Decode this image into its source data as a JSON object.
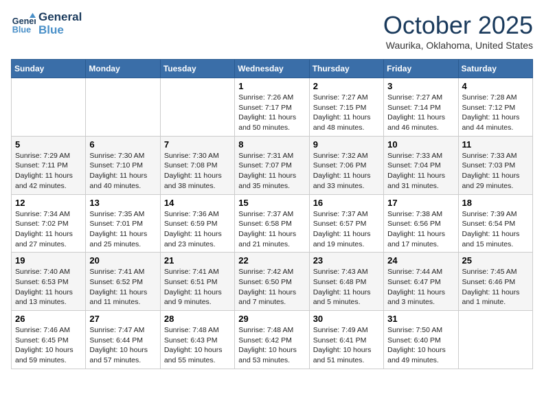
{
  "header": {
    "logo_line1": "General",
    "logo_line2": "Blue",
    "month": "October 2025",
    "location": "Waurika, Oklahoma, United States"
  },
  "weekdays": [
    "Sunday",
    "Monday",
    "Tuesday",
    "Wednesday",
    "Thursday",
    "Friday",
    "Saturday"
  ],
  "weeks": [
    [
      {
        "day": "",
        "info": ""
      },
      {
        "day": "",
        "info": ""
      },
      {
        "day": "",
        "info": ""
      },
      {
        "day": "1",
        "info": "Sunrise: 7:26 AM\nSunset: 7:17 PM\nDaylight: 11 hours\nand 50 minutes."
      },
      {
        "day": "2",
        "info": "Sunrise: 7:27 AM\nSunset: 7:15 PM\nDaylight: 11 hours\nand 48 minutes."
      },
      {
        "day": "3",
        "info": "Sunrise: 7:27 AM\nSunset: 7:14 PM\nDaylight: 11 hours\nand 46 minutes."
      },
      {
        "day": "4",
        "info": "Sunrise: 7:28 AM\nSunset: 7:12 PM\nDaylight: 11 hours\nand 44 minutes."
      }
    ],
    [
      {
        "day": "5",
        "info": "Sunrise: 7:29 AM\nSunset: 7:11 PM\nDaylight: 11 hours\nand 42 minutes."
      },
      {
        "day": "6",
        "info": "Sunrise: 7:30 AM\nSunset: 7:10 PM\nDaylight: 11 hours\nand 40 minutes."
      },
      {
        "day": "7",
        "info": "Sunrise: 7:30 AM\nSunset: 7:08 PM\nDaylight: 11 hours\nand 38 minutes."
      },
      {
        "day": "8",
        "info": "Sunrise: 7:31 AM\nSunset: 7:07 PM\nDaylight: 11 hours\nand 35 minutes."
      },
      {
        "day": "9",
        "info": "Sunrise: 7:32 AM\nSunset: 7:06 PM\nDaylight: 11 hours\nand 33 minutes."
      },
      {
        "day": "10",
        "info": "Sunrise: 7:33 AM\nSunset: 7:04 PM\nDaylight: 11 hours\nand 31 minutes."
      },
      {
        "day": "11",
        "info": "Sunrise: 7:33 AM\nSunset: 7:03 PM\nDaylight: 11 hours\nand 29 minutes."
      }
    ],
    [
      {
        "day": "12",
        "info": "Sunrise: 7:34 AM\nSunset: 7:02 PM\nDaylight: 11 hours\nand 27 minutes."
      },
      {
        "day": "13",
        "info": "Sunrise: 7:35 AM\nSunset: 7:01 PM\nDaylight: 11 hours\nand 25 minutes."
      },
      {
        "day": "14",
        "info": "Sunrise: 7:36 AM\nSunset: 6:59 PM\nDaylight: 11 hours\nand 23 minutes."
      },
      {
        "day": "15",
        "info": "Sunrise: 7:37 AM\nSunset: 6:58 PM\nDaylight: 11 hours\nand 21 minutes."
      },
      {
        "day": "16",
        "info": "Sunrise: 7:37 AM\nSunset: 6:57 PM\nDaylight: 11 hours\nand 19 minutes."
      },
      {
        "day": "17",
        "info": "Sunrise: 7:38 AM\nSunset: 6:56 PM\nDaylight: 11 hours\nand 17 minutes."
      },
      {
        "day": "18",
        "info": "Sunrise: 7:39 AM\nSunset: 6:54 PM\nDaylight: 11 hours\nand 15 minutes."
      }
    ],
    [
      {
        "day": "19",
        "info": "Sunrise: 7:40 AM\nSunset: 6:53 PM\nDaylight: 11 hours\nand 13 minutes."
      },
      {
        "day": "20",
        "info": "Sunrise: 7:41 AM\nSunset: 6:52 PM\nDaylight: 11 hours\nand 11 minutes."
      },
      {
        "day": "21",
        "info": "Sunrise: 7:41 AM\nSunset: 6:51 PM\nDaylight: 11 hours\nand 9 minutes."
      },
      {
        "day": "22",
        "info": "Sunrise: 7:42 AM\nSunset: 6:50 PM\nDaylight: 11 hours\nand 7 minutes."
      },
      {
        "day": "23",
        "info": "Sunrise: 7:43 AM\nSunset: 6:48 PM\nDaylight: 11 hours\nand 5 minutes."
      },
      {
        "day": "24",
        "info": "Sunrise: 7:44 AM\nSunset: 6:47 PM\nDaylight: 11 hours\nand 3 minutes."
      },
      {
        "day": "25",
        "info": "Sunrise: 7:45 AM\nSunset: 6:46 PM\nDaylight: 11 hours\nand 1 minute."
      }
    ],
    [
      {
        "day": "26",
        "info": "Sunrise: 7:46 AM\nSunset: 6:45 PM\nDaylight: 10 hours\nand 59 minutes."
      },
      {
        "day": "27",
        "info": "Sunrise: 7:47 AM\nSunset: 6:44 PM\nDaylight: 10 hours\nand 57 minutes."
      },
      {
        "day": "28",
        "info": "Sunrise: 7:48 AM\nSunset: 6:43 PM\nDaylight: 10 hours\nand 55 minutes."
      },
      {
        "day": "29",
        "info": "Sunrise: 7:48 AM\nSunset: 6:42 PM\nDaylight: 10 hours\nand 53 minutes."
      },
      {
        "day": "30",
        "info": "Sunrise: 7:49 AM\nSunset: 6:41 PM\nDaylight: 10 hours\nand 51 minutes."
      },
      {
        "day": "31",
        "info": "Sunrise: 7:50 AM\nSunset: 6:40 PM\nDaylight: 10 hours\nand 49 minutes."
      },
      {
        "day": "",
        "info": ""
      }
    ]
  ]
}
